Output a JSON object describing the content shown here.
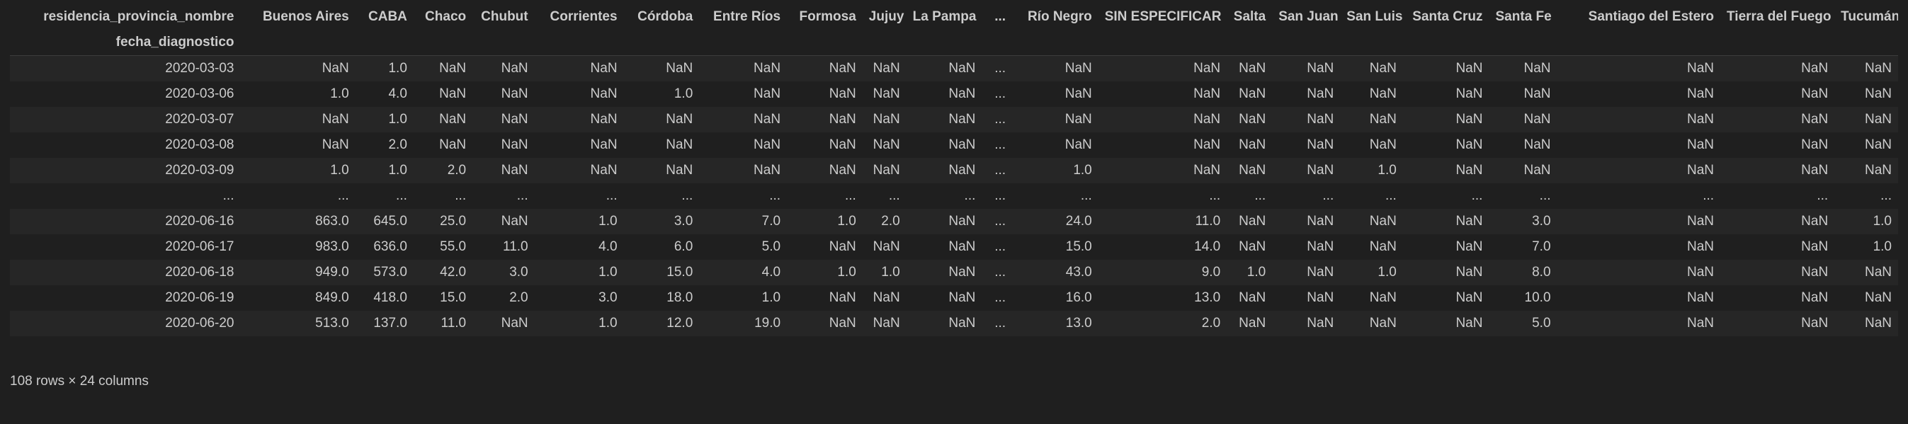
{
  "table": {
    "columns_label": "residencia_provincia_nombre",
    "index_name": "fecha_diagnostico",
    "columns": [
      "Buenos Aires",
      "CABA",
      "Chaco",
      "Chubut",
      "Corrientes",
      "Córdoba",
      "Entre Ríos",
      "Formosa",
      "Jujuy",
      "La Pampa",
      "...",
      "Río Negro",
      "SIN ESPECIFICAR",
      "Salta",
      "San Juan",
      "San Luis",
      "Santa Cruz",
      "Santa Fe",
      "Santiago del Estero",
      "Tierra del Fuego",
      "Tucumán"
    ],
    "rows": [
      {
        "index": "2020-03-03",
        "cells": [
          "NaN",
          "1.0",
          "NaN",
          "NaN",
          "NaN",
          "NaN",
          "NaN",
          "NaN",
          "NaN",
          "NaN",
          "...",
          "NaN",
          "NaN",
          "NaN",
          "NaN",
          "NaN",
          "NaN",
          "NaN",
          "NaN",
          "NaN",
          "NaN"
        ]
      },
      {
        "index": "2020-03-06",
        "cells": [
          "1.0",
          "4.0",
          "NaN",
          "NaN",
          "NaN",
          "1.0",
          "NaN",
          "NaN",
          "NaN",
          "NaN",
          "...",
          "NaN",
          "NaN",
          "NaN",
          "NaN",
          "NaN",
          "NaN",
          "NaN",
          "NaN",
          "NaN",
          "NaN"
        ]
      },
      {
        "index": "2020-03-07",
        "cells": [
          "NaN",
          "1.0",
          "NaN",
          "NaN",
          "NaN",
          "NaN",
          "NaN",
          "NaN",
          "NaN",
          "NaN",
          "...",
          "NaN",
          "NaN",
          "NaN",
          "NaN",
          "NaN",
          "NaN",
          "NaN",
          "NaN",
          "NaN",
          "NaN"
        ]
      },
      {
        "index": "2020-03-08",
        "cells": [
          "NaN",
          "2.0",
          "NaN",
          "NaN",
          "NaN",
          "NaN",
          "NaN",
          "NaN",
          "NaN",
          "NaN",
          "...",
          "NaN",
          "NaN",
          "NaN",
          "NaN",
          "NaN",
          "NaN",
          "NaN",
          "NaN",
          "NaN",
          "NaN"
        ]
      },
      {
        "index": "2020-03-09",
        "cells": [
          "1.0",
          "1.0",
          "2.0",
          "NaN",
          "NaN",
          "NaN",
          "NaN",
          "NaN",
          "NaN",
          "NaN",
          "...",
          "1.0",
          "NaN",
          "NaN",
          "NaN",
          "1.0",
          "NaN",
          "NaN",
          "NaN",
          "NaN",
          "NaN"
        ]
      },
      {
        "index": "...",
        "cells": [
          "...",
          "...",
          "...",
          "...",
          "...",
          "...",
          "...",
          "...",
          "...",
          "...",
          "...",
          "...",
          "...",
          "...",
          "...",
          "...",
          "...",
          "...",
          "...",
          "...",
          "..."
        ]
      },
      {
        "index": "2020-06-16",
        "cells": [
          "863.0",
          "645.0",
          "25.0",
          "NaN",
          "1.0",
          "3.0",
          "7.0",
          "1.0",
          "2.0",
          "NaN",
          "...",
          "24.0",
          "11.0",
          "NaN",
          "NaN",
          "NaN",
          "NaN",
          "3.0",
          "NaN",
          "NaN",
          "1.0"
        ]
      },
      {
        "index": "2020-06-17",
        "cells": [
          "983.0",
          "636.0",
          "55.0",
          "11.0",
          "4.0",
          "6.0",
          "5.0",
          "NaN",
          "NaN",
          "NaN",
          "...",
          "15.0",
          "14.0",
          "NaN",
          "NaN",
          "NaN",
          "NaN",
          "7.0",
          "NaN",
          "NaN",
          "1.0"
        ]
      },
      {
        "index": "2020-06-18",
        "cells": [
          "949.0",
          "573.0",
          "42.0",
          "3.0",
          "1.0",
          "15.0",
          "4.0",
          "1.0",
          "1.0",
          "NaN",
          "...",
          "43.0",
          "9.0",
          "1.0",
          "NaN",
          "1.0",
          "NaN",
          "8.0",
          "NaN",
          "NaN",
          "NaN"
        ]
      },
      {
        "index": "2020-06-19",
        "cells": [
          "849.0",
          "418.0",
          "15.0",
          "2.0",
          "3.0",
          "18.0",
          "1.0",
          "NaN",
          "NaN",
          "NaN",
          "...",
          "16.0",
          "13.0",
          "NaN",
          "NaN",
          "NaN",
          "NaN",
          "10.0",
          "NaN",
          "NaN",
          "NaN"
        ]
      },
      {
        "index": "2020-06-20",
        "cells": [
          "513.0",
          "137.0",
          "11.0",
          "NaN",
          "1.0",
          "12.0",
          "19.0",
          "NaN",
          "NaN",
          "NaN",
          "...",
          "13.0",
          "2.0",
          "NaN",
          "NaN",
          "NaN",
          "NaN",
          "5.0",
          "NaN",
          "NaN",
          "NaN"
        ]
      }
    ],
    "shape_text": "108 rows × 24 columns"
  }
}
